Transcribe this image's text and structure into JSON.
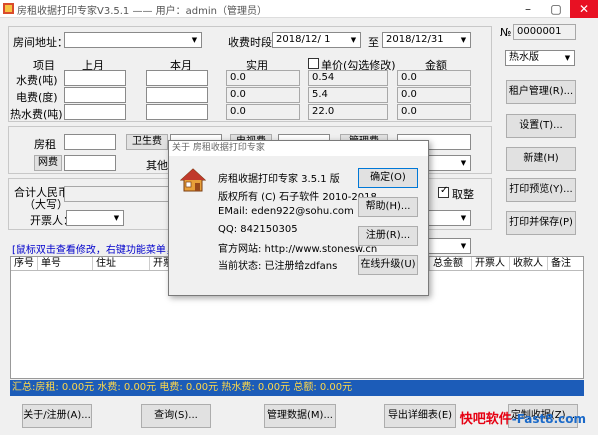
{
  "window": {
    "title": "房租收据打印专家V3.5.1 —— 用户：admin（管理员）"
  },
  "form": {
    "address_label": "房间地址：",
    "address_value": "",
    "period_label": "收费时段：",
    "period_from": "2018/12/ 1",
    "period_to_label": "至",
    "period_to": "2018/12/31",
    "no_label": "№",
    "no_value": "0000001",
    "water_heater_select": "热水版",
    "col_item": "项目",
    "col_last": "上月",
    "col_this": "本月",
    "col_actual": "实用",
    "col_price": "单价(勾选修改)",
    "col_amount": "金额",
    "rows": [
      {
        "label": "水费(吨)",
        "last": "",
        "this": "",
        "actual": "0.0",
        "price": "0.54",
        "amount": "0.0"
      },
      {
        "label": "电费(度)",
        "last": "",
        "this": "",
        "actual": "0.0",
        "price": "5.4",
        "amount": "0.0"
      },
      {
        "label": "热水费(吨)",
        "last": "",
        "this": "",
        "actual": "0.0",
        "price": "22.0",
        "amount": "0.0"
      }
    ],
    "rent_label": "房租",
    "sanitation_label": "卫生费",
    "tv_label": "电视费",
    "mgmt_label": "管理费",
    "internet_label": "网费",
    "other_label": "其他",
    "total_label_1": "合计人民币",
    "total_label_2": "（大写）",
    "issuer_label": "开票人：",
    "round_label": "取整"
  },
  "side_buttons": {
    "tenant_mgmt": "租户管理(R)...",
    "settings": "设置(T)...",
    "new": "新建(H)",
    "print_preview": "打印预览(Y)...",
    "print_save": "打印并保存(P)"
  },
  "hint": "[鼠标双击查看修改，右键功能菜单，可按住",
  "table": {
    "headers": [
      "序号",
      "单号",
      "住址",
      "开票",
      "",
      "",
      "",
      "",
      "",
      "总金额",
      "开票人",
      "收款人",
      "备注"
    ]
  },
  "summary": "汇总:房租: 0.00元  水费: 0.00元  电费: 0.00元  热水费: 0.00元  总额: 0.00元",
  "bottom_buttons": {
    "about": "关于/注册(A)...",
    "query": "查询(S)...",
    "manage_data": "管理数据(M)...",
    "export": "导出详细表(E)",
    "customize": "定制收据(Z)..."
  },
  "dialog": {
    "title": "关于 房租收据打印专家",
    "product": "房租收据打印专家 3.5.1 版",
    "copyright": "版权所有 (C) 石子软件 2010-2018",
    "email": "EMail: eden922@sohu.com",
    "qq": "QQ: 842150305",
    "website": "官方网站: http://www.stonesw.cn",
    "status": "当前状态: 已注册给zdfans",
    "ok_button": "确定(O)",
    "help_button": "帮助(H)...",
    "register_button": "注册(R)...",
    "upgrade_button": "在线升级(U)"
  },
  "watermark": {
    "text1": "快吧软件",
    "text2": "-Fast8.com"
  },
  "colors": {
    "summary_bg": "#1c5cb8",
    "summary_text": "#ffd84a",
    "hint_text": "#0000cc",
    "close_red": "#e81123"
  }
}
